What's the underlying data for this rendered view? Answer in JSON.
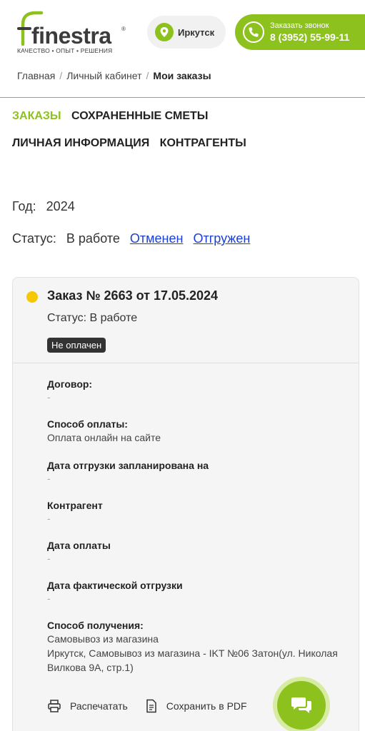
{
  "header": {
    "logo_text": "finestra",
    "logo_reg": "®",
    "logo_tagline": "КАЧЕСТВО • ОПЫТ • РЕШЕНИЯ",
    "city": "Иркутск",
    "callback_label": "Заказать звонок",
    "phone": "8 (3952) 55-99-11"
  },
  "breadcrumb": {
    "home": "Главная",
    "cabinet": "Личный кабинет",
    "current": "Мои заказы"
  },
  "tabs": {
    "orders": "ЗАКАЗЫ",
    "saved_estimates": "СОХРАНЕННЫЕ СМЕТЫ",
    "personal_info": "ЛИЧНАЯ ИНФОРМАЦИЯ",
    "counterparties": "КОНТРАГЕНТЫ"
  },
  "filters": {
    "year_label": "Год:",
    "year_value": "2024",
    "status_label": "Статус:",
    "status_current": "В работе",
    "status_cancelled": "Отменен",
    "status_shipped": "Отгружен"
  },
  "order": {
    "title": "Заказ № 2663 от 17.05.2024",
    "status": "Статус: В работе",
    "payment_badge": "Не оплачен",
    "status_color": "#f5c800",
    "fields": {
      "contract_label": "Договор:",
      "contract_value": "-",
      "payment_method_label": "Способ оплаты:",
      "payment_method_value": "Оплата онлайн на сайте",
      "planned_shipment_label": "Дата отгрузки запланирована на",
      "planned_shipment_value": "-",
      "counterparty_label": "Контрагент",
      "counterparty_value": "-",
      "payment_date_label": "Дата оплаты",
      "payment_date_value": "-",
      "actual_shipment_label": "Дата фактической отгрузки",
      "actual_shipment_value": "-",
      "delivery_label": "Способ получения:",
      "delivery_value_1": "Самовывоз из магазина",
      "delivery_value_2": "Иркутск, Самовывоз из магазина - IKT №06 Затон(ул. Николая Вилкова 9А, стр.1)"
    },
    "actions": {
      "print": "Распечатать",
      "save_pdf": "Сохранить в PDF"
    }
  },
  "colors": {
    "accent": "#8dc11e",
    "link": "#1a3fd4"
  }
}
